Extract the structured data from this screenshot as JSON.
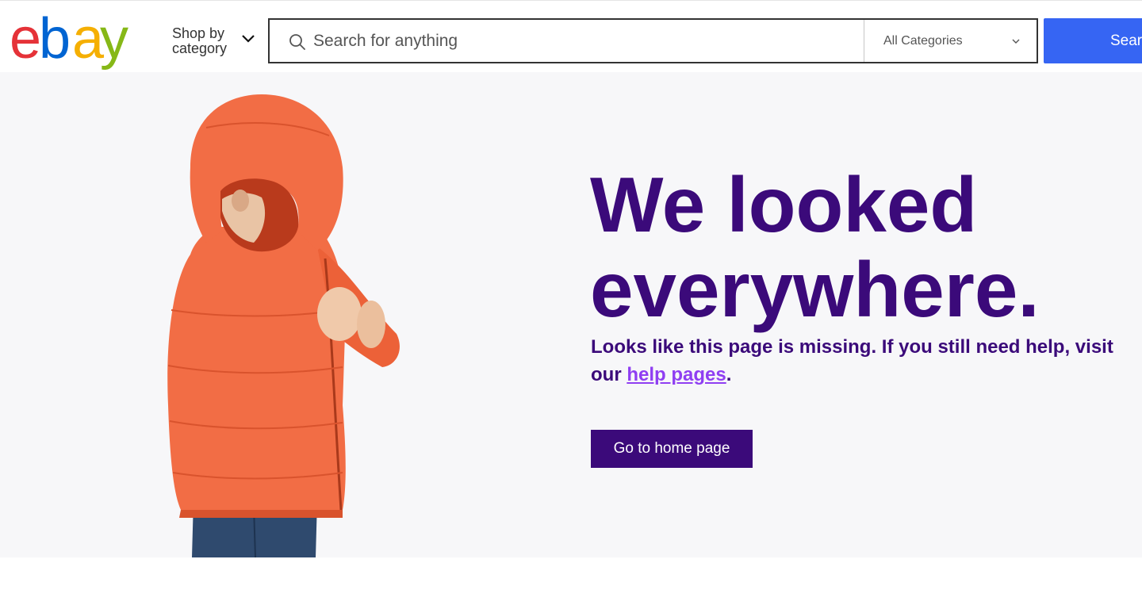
{
  "header": {
    "logo": {
      "letters": [
        "e",
        "b",
        "a",
        "y"
      ],
      "colors": [
        "#e53238",
        "#0064d2",
        "#f5af02",
        "#86b817"
      ]
    },
    "shop_by": {
      "line1": "Shop by",
      "line2": "category",
      "icon": "chevron-down-icon"
    },
    "search": {
      "placeholder": "Search for anything",
      "icon": "search-icon",
      "category": "All Categories",
      "category_icon": "chevron-down-icon",
      "button_label": "Search",
      "button_color": "#3665f3"
    }
  },
  "hero": {
    "headline_line1": "We looked",
    "headline_line2": "everywhere.",
    "message_before": "Looks like this page is missing. If you still need help, visit our ",
    "help_link": "help pages",
    "message_after": ".",
    "home_button": "Go to home page",
    "accent_color": "#3b0a7a",
    "link_color": "#8f3ef2",
    "image": "child-in-orange-puffer-jacket"
  }
}
